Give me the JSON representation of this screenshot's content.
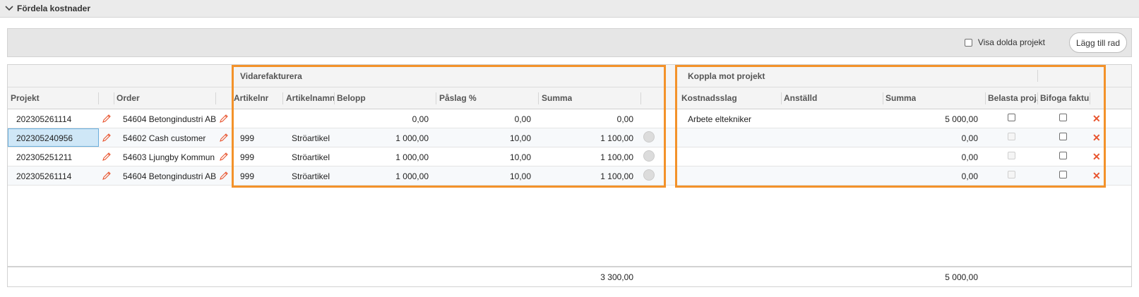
{
  "section": {
    "title": "Fördela kostnader"
  },
  "toolbar": {
    "show_hidden_label": "Visa dolda projekt",
    "add_row_label": "Lägg till rad"
  },
  "groups": {
    "reinvoice": "Vidarefakturera",
    "link_project": "Koppla mot projekt"
  },
  "columns": {
    "project": "Projekt",
    "order": "Order",
    "article_no": "Artikelnr",
    "article_name": "Artikelnamn",
    "amount": "Belopp",
    "markup": "Påslag %",
    "sum": "Summa",
    "cost_type": "Kostnadsslag",
    "employee": "Anställd",
    "sum2": "Summa",
    "charge_project": "Belasta proj...",
    "attach_invoice": "Bifoga faktu..."
  },
  "rows": [
    {
      "project": "202305261114",
      "order": "54604 Betongindustri AB",
      "article_no": "",
      "article_name": "",
      "amount": "0,00",
      "markup": "0,00",
      "sum": "0,00",
      "cost_type": "Arbete eltekniker",
      "employee": "",
      "sum2": "5 000,00"
    },
    {
      "project": "202305240956",
      "order": "54602 Cash customer",
      "article_no": "999",
      "article_name": "Ströartikel",
      "amount": "1 000,00",
      "markup": "10,00",
      "sum": "1 100,00",
      "cost_type": "",
      "employee": "",
      "sum2": "0,00"
    },
    {
      "project": "202305251211",
      "order": "54603 Ljungby Kommun",
      "article_no": "999",
      "article_name": "Ströartikel",
      "amount": "1 000,00",
      "markup": "10,00",
      "sum": "1 100,00",
      "cost_type": "",
      "employee": "",
      "sum2": "0,00"
    },
    {
      "project": "202305261114",
      "order": "54604 Betongindustri AB",
      "article_no": "999",
      "article_name": "Ströartikel",
      "amount": "1 000,00",
      "markup": "10,00",
      "sum": "1 100,00",
      "cost_type": "",
      "employee": "",
      "sum2": "0,00"
    }
  ],
  "totals": {
    "sum": "3 300,00",
    "sum2": "5 000,00"
  },
  "colors": {
    "accent_highlight": "#f3922a",
    "delete": "#e8542e",
    "selection": "#cfe7f7"
  },
  "icons": {
    "collapse": "chevron-down-icon",
    "edit": "pencil-icon",
    "delete": "close-icon",
    "status": "circle-icon"
  }
}
